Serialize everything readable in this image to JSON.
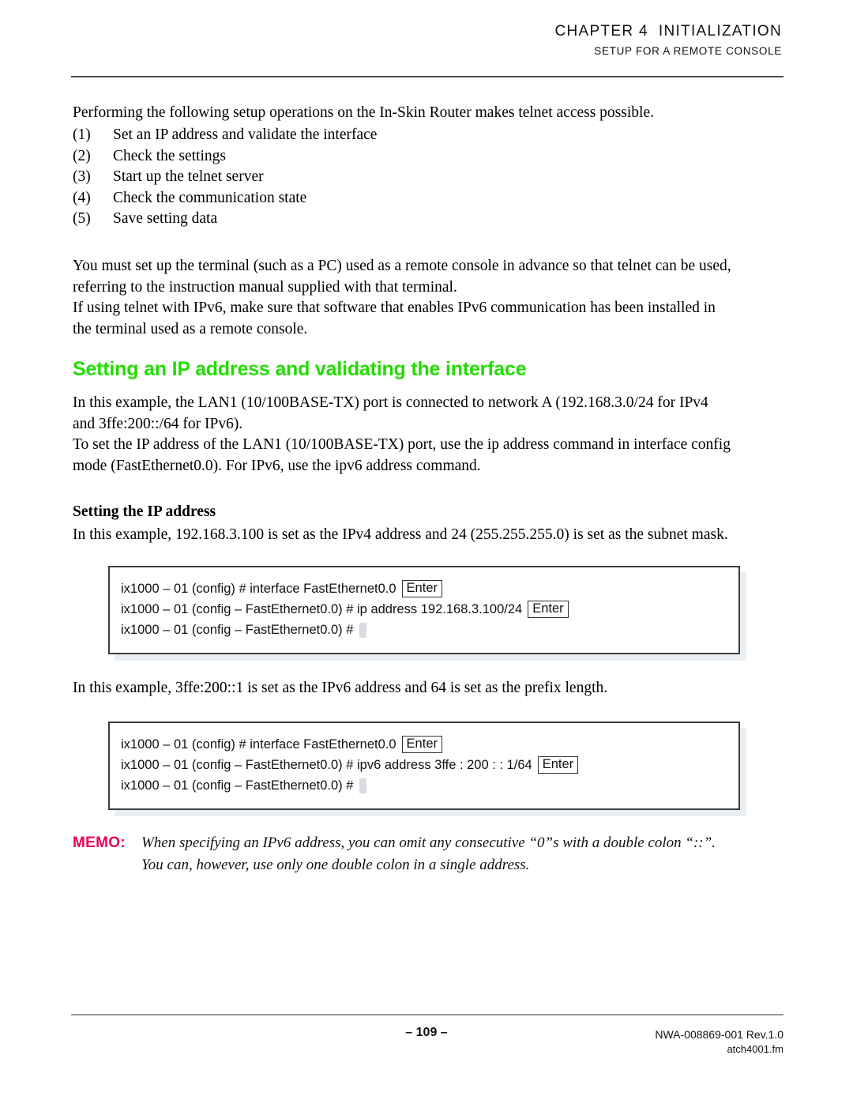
{
  "header": {
    "chapter": "CHAPTER 4",
    "chapter_title": "INITIALIZATION",
    "subtitle": "SETUP FOR A REMOTE CONSOLE"
  },
  "intro": {
    "lead": "Performing the following setup operations on the In-Skin Router makes telnet access possible."
  },
  "steps": [
    {
      "num": "(1)",
      "text": "Set an IP address and validate the interface"
    },
    {
      "num": "(2)",
      "text": "Check the settings"
    },
    {
      "num": "(3)",
      "text": "Start up the telnet server"
    },
    {
      "num": "(4)",
      "text": "Check the communication state"
    },
    {
      "num": "(5)",
      "text": "Save setting data"
    }
  ],
  "paragraphs": {
    "terminal_setup_line1": "You must set up the terminal (such as a PC) used as a remote console in advance so that telnet can be used,",
    "terminal_setup_line2": "referring to the instruction manual supplied with that terminal.",
    "ipv6_software_line1": "If using telnet with IPv6, make sure that software that enables IPv6 communication has been installed in",
    "ipv6_software_line2": "the terminal used as a remote console."
  },
  "section": {
    "heading": "Setting an IP address and validating the interface",
    "heading_color": "#22dd00",
    "example_line1": "In this example, the LAN1 (10/100BASE-TX) port is connected to network A (192.168.3.0/24 for IPv4",
    "example_line2": "and 3ffe:200::/64 for IPv6).",
    "command_line1": "To set the IP address of the LAN1 (10/100BASE-TX) port, use the ip address command in interface config",
    "command_line2": "mode (FastEthernet0.0). For IPv6, use the ipv6 address command."
  },
  "ip_address": {
    "subhead": "Setting the IP address",
    "description": "In this example, 192.168.3.100 is set as the IPv4 address and 24 (255.255.255.0) is set as the subnet mask.",
    "console": [
      {
        "prompt": "ix1000 – 01 (config) # interface FastEthernet0.0",
        "key": "Enter",
        "cursor": false
      },
      {
        "prompt": "ix1000 – 01 (config – FastEthernet0.0) # ip address 192.168.3.100/24",
        "key": "Enter",
        "cursor": false
      },
      {
        "prompt": "ix1000 – 01 (config – FastEthernet0.0) #",
        "key": "",
        "cursor": true
      }
    ]
  },
  "ipv6_address": {
    "description": "In this example, 3ffe:200::1 is set as the IPv6 address and 64 is set as the prefix length.",
    "console": [
      {
        "prompt": "ix1000 – 01 (config) # interface FastEthernet0.0",
        "key": "Enter",
        "cursor": false
      },
      {
        "prompt": "ix1000 – 01 (config – FastEthernet0.0) # ipv6 address 3ffe : 200 : : 1/64",
        "key": "Enter",
        "cursor": false
      },
      {
        "prompt": "ix1000 – 01 (config – FastEthernet0.0) #",
        "key": "",
        "cursor": true
      }
    ]
  },
  "memo": {
    "label": "MEMO:",
    "label_color": "#e8005c",
    "line1": "When specifying an IPv6 address, you can omit any consecutive “0”s with a double colon “::”.",
    "line2": "You can, however, use only one double colon in a single address."
  },
  "footer": {
    "page_number": "– 109 –",
    "doc_number": "NWA-008869-001 Rev.1.0",
    "file_name": "atch4001.fm"
  }
}
